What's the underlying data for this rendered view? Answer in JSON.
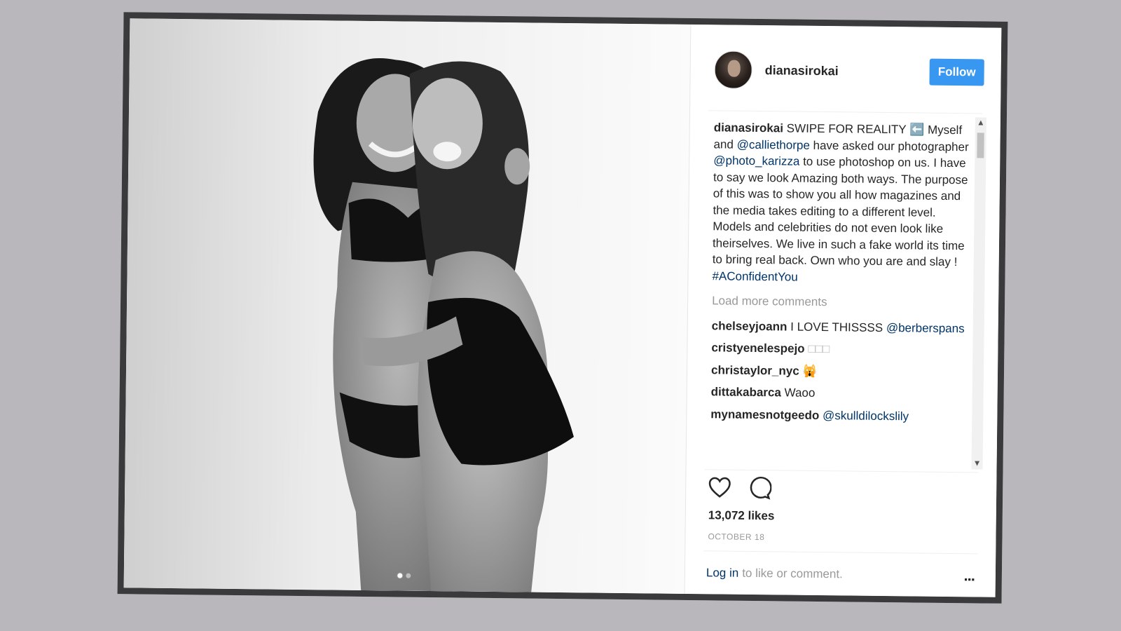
{
  "post": {
    "username": "dianasirokai",
    "follow_label": "Follow",
    "caption": {
      "username": "dianasirokai",
      "text_1": "SWIPE FOR REALITY ⬅️ Myself and",
      "mention_1": "@calliethorpe",
      "text_2": "have asked our photographer",
      "mention_2": "@photo_karizza",
      "text_3": "to use photoshop on us. I have to say we look Amazing both ways. The purpose of this was to show you all how magazines and the media takes editing to a different level. Models and celebrities do not even look like theirselves. We live in such a fake world its time to bring real back. Own who you are and slay !",
      "hashtag": "#AConfidentYou"
    },
    "load_more": "Load more comments",
    "comments": [
      {
        "user": "chelseyjoann",
        "text": "I LOVE THISSSS",
        "mention": "@berberspans"
      },
      {
        "user": "cristyenelespejo",
        "text": "□□□",
        "mention": ""
      },
      {
        "user": "christaylor_nyc",
        "text": "🙀",
        "mention": ""
      },
      {
        "user": "dittakabarca",
        "text": "Waoo",
        "mention": ""
      },
      {
        "user": "mynamesnotgeedo",
        "text": "",
        "mention": "@skulldilockslily"
      }
    ],
    "likes": "13,072 likes",
    "date": "OCTOBER 18",
    "login_link": "Log in",
    "login_text": "to like or comment.",
    "more_label": "...",
    "icons": {
      "like": "heart-icon",
      "comment": "comment-icon",
      "scroll_up": "scroll-up-arrow-icon",
      "scroll_down": "scroll-down-arrow-icon"
    },
    "colors": {
      "accent": "#3897f0",
      "link": "#003569",
      "muted": "#999999"
    }
  }
}
